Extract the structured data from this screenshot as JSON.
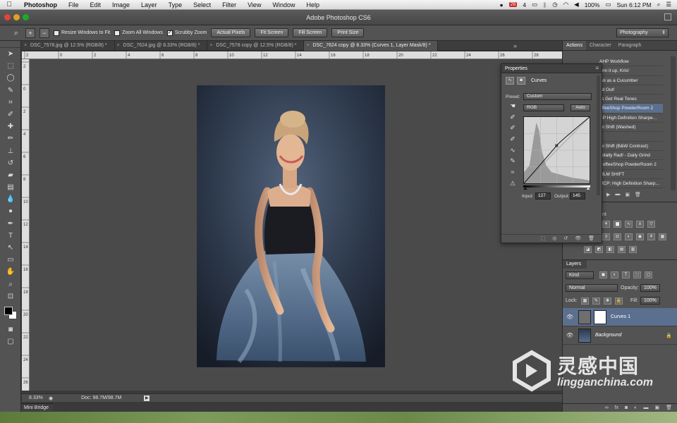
{
  "menubar": {
    "app_name": "Photoshop",
    "items": [
      "File",
      "Edit",
      "Image",
      "Layer",
      "Type",
      "Select",
      "Filter",
      "View",
      "Window",
      "Help"
    ],
    "status": {
      "battery": "100%",
      "clock": "Sun 6:12 PM",
      "badge": "26",
      "count": "4"
    }
  },
  "window": {
    "title": "Adobe Photoshop CS6"
  },
  "options_bar": {
    "resize_windows": "Resize Windows to Fit",
    "zoom_all_windows": "Zoom All Windows",
    "scrubby_zoom": "Scrubby Zoom",
    "scrubby_checked": true,
    "actual_pixels": "Actual Pixels",
    "fit_screen": "Fit Screen",
    "fill_screen": "Fill Screen",
    "print_size": "Print Size",
    "workspace": "Photography"
  },
  "tabs": [
    {
      "label": "DSC_7578.jpg @ 12.5% (RGB/8) *",
      "active": false
    },
    {
      "label": "DSC_7624.jpg @ 8.33% (RGB/8) *",
      "active": false
    },
    {
      "label": "DSC_7578 copy @ 12.5% (RGB/8) *",
      "active": false
    },
    {
      "label": "DSC_7624 copy @ 8.33% (Curves 1, Layer Mask/8) *",
      "active": true
    }
  ],
  "statusbar": {
    "zoom": "8.33%",
    "doc": "Doc: 98.7M/98.7M",
    "mini_bridge": "Mini Bridge"
  },
  "ruler": {
    "top_ticks": [
      "2",
      "0",
      "2",
      "4",
      "6",
      "8",
      "10",
      "12",
      "14",
      "16",
      "18",
      "20",
      "22",
      "24",
      "26",
      "28"
    ],
    "left_ticks": [
      "2",
      "0",
      "2",
      "4",
      "6",
      "8",
      "10",
      "12",
      "14",
      "16",
      "18",
      "20",
      "22",
      "24",
      "26"
    ]
  },
  "dock": {
    "tabs": [
      "Actions",
      "Character",
      "Paragraph"
    ],
    "actions": [
      {
        "label": "AHP Workflow",
        "selected": false
      },
      {
        "label": "arm it up, Kris!",
        "selected": false
      },
      {
        "label": "ool as a Cucumber",
        "selected": false
      },
      {
        "label": "nd Out!",
        "selected": false
      },
      {
        "label": "t's Get Real Tones",
        "selected": false
      },
      {
        "label": "offeeShop PowderRoom 2",
        "selected": true
      },
      {
        "label": "CP High Definition Sharpe...",
        "selected": false
      },
      {
        "label": "lm Shift (Washed)",
        "selected": false
      },
      {
        "label": "",
        "selected": false
      },
      {
        "label": "lm Shift (B&W Contrast)",
        "selected": false
      },
      {
        "label": "Totally Rad! - Daily Grind",
        "selected": false
      },
      {
        "label": "CoffeeShop PowderRoom 2",
        "selected": false
      },
      {
        "label": "FILM SHIFT",
        "selected": false
      },
      {
        "label": "MCP: High Definition Sharp...",
        "selected": false
      }
    ],
    "adjustments_label": "nt"
  },
  "layers": {
    "tab": "Layers",
    "filter": "Kind",
    "blend_mode": "Normal",
    "opacity_label": "Opacity:",
    "opacity": "100%",
    "lock_label": "Lock:",
    "fill_label": "Fill:",
    "fill": "100%",
    "rows": [
      {
        "name": "Curves 1",
        "selected": true
      },
      {
        "name": "Background",
        "selected": false
      }
    ]
  },
  "properties": {
    "title": "Properties",
    "panel_name": "Curves",
    "preset_label": "Preset:",
    "preset": "Custom",
    "channel": "RGB",
    "auto": "Auto",
    "input_label": "Input:",
    "input": "127",
    "output_label": "Output:",
    "output": "145",
    "curve_point": {
      "input": 127,
      "output": 145
    }
  },
  "watermark": {
    "cn": "灵感中国",
    "en": "lingganchina.com"
  }
}
